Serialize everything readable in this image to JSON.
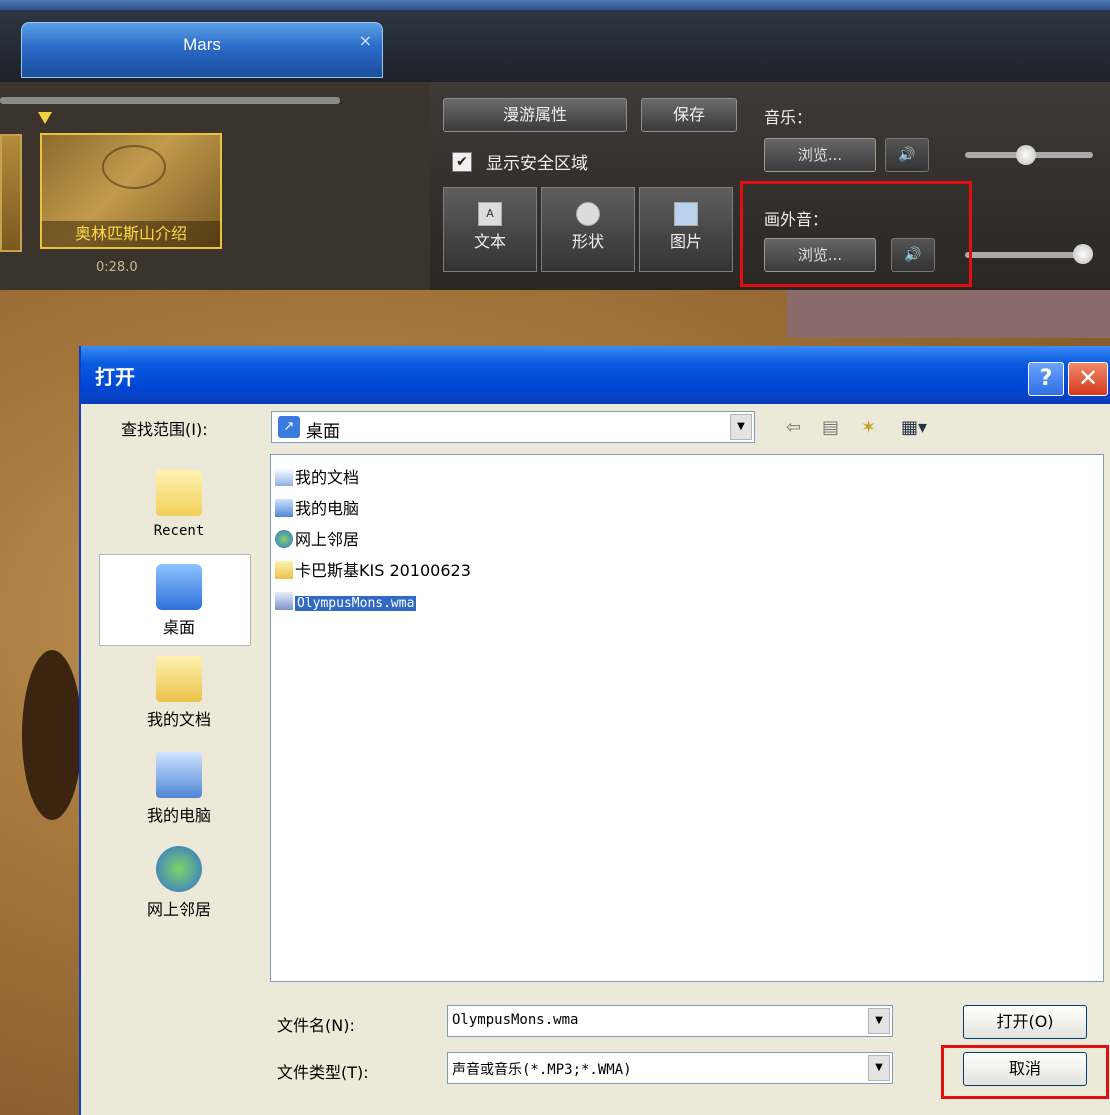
{
  "app": {
    "tab_title": "Mars",
    "tab_close": "×",
    "tour_props_label": "漫游属性",
    "save_label": "保存",
    "show_safe_area_label": "显示安全区域",
    "show_safe_area_checked": true,
    "tools": [
      {
        "label": "文本",
        "icon": "text-icon"
      },
      {
        "label": "形状",
        "icon": "shape-icon"
      },
      {
        "label": "图片",
        "icon": "image-icon"
      }
    ],
    "music_label": "音乐：",
    "voiceover_label": "画外音：",
    "browse_label": "浏览...",
    "clip_title": "奥林匹斯山介绍",
    "clip_time": "0:28.0",
    "music_volume": 0.6,
    "voiceover_volume": 1.0
  },
  "dialog": {
    "title": "打开",
    "help": "?",
    "close": "✕",
    "lookin_label": "查找范围(I):",
    "lookin_value": "桌面",
    "places": [
      {
        "label": "Recent",
        "icon": "recent-folder-icon"
      },
      {
        "label": "桌面",
        "icon": "desktop-icon"
      },
      {
        "label": "我的文档",
        "icon": "my-documents-icon"
      },
      {
        "label": "我的电脑",
        "icon": "my-computer-icon"
      },
      {
        "label": "网上邻居",
        "icon": "network-places-icon"
      }
    ],
    "files": [
      {
        "name": "我的文档",
        "icon": "my-documents-icon"
      },
      {
        "name": "我的电脑",
        "icon": "my-computer-icon"
      },
      {
        "name": "网上邻居",
        "icon": "network-places-icon"
      },
      {
        "name": "卡巴斯基KIS 20100623",
        "icon": "folder-icon"
      },
      {
        "name": "OlympusMons.wma",
        "icon": "wma-file-icon",
        "selected": true
      }
    ],
    "filename_label": "文件名(N):",
    "filename_value": "OlympusMons.wma",
    "filetype_label": "文件类型(T):",
    "filetype_value": "声音或音乐(*.MP3;*.WMA)",
    "open_label": "打开(O)",
    "cancel_label": "取消"
  },
  "colors": {
    "highlight_red": "#e01010",
    "xp_blue": "#0046d6",
    "selection_blue": "#316ac5"
  }
}
